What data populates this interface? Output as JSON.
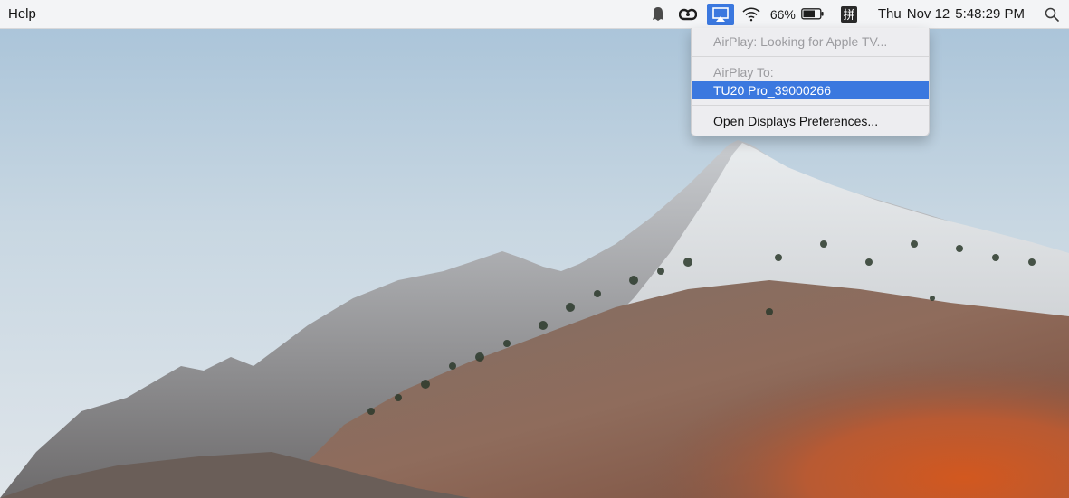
{
  "menubar": {
    "help_label": "Help",
    "battery_percent": "66%",
    "clock": {
      "day": "Thu",
      "date": "Nov 12",
      "time": "5:48:29 PM"
    },
    "status_icons": [
      "ghost-icon",
      "creative-cloud-icon",
      "airplay-icon",
      "wifi-icon",
      "battery-icon",
      "pinyin-input-icon",
      "spotlight-search-icon"
    ],
    "ime_glyph": "拼"
  },
  "airplay_menu": {
    "status_text": "AirPlay: Looking for Apple TV...",
    "section_label": "AirPlay To:",
    "device": "TU20 Pro_39000266",
    "preferences_label": "Open Displays Preferences..."
  },
  "colors": {
    "accent": "#3b78df",
    "menubar_bg": "#f6f6f7"
  }
}
